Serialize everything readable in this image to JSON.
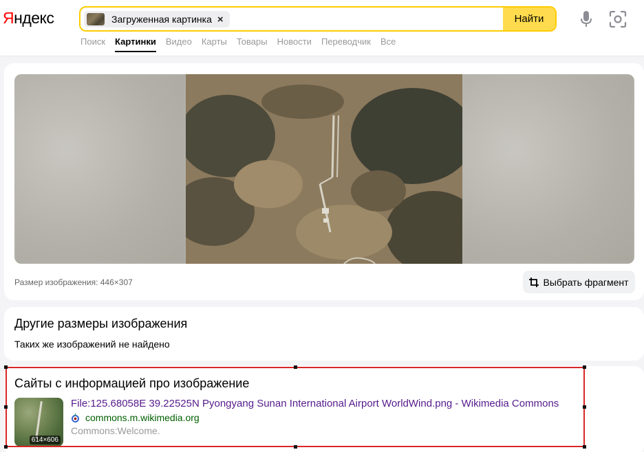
{
  "header": {
    "logo": "Яндекс",
    "chip_label": "Загруженная картинка",
    "chip_close": "×",
    "search_button": "Найти"
  },
  "nav": {
    "tabs": [
      {
        "label": "Поиск",
        "active": false
      },
      {
        "label": "Картинки",
        "active": true
      },
      {
        "label": "Видео",
        "active": false
      },
      {
        "label": "Карты",
        "active": false
      },
      {
        "label": "Товары",
        "active": false
      },
      {
        "label": "Новости",
        "active": false
      },
      {
        "label": "Переводчик",
        "active": false
      },
      {
        "label": "Все",
        "active": false
      }
    ]
  },
  "preview": {
    "size_text": "Размер изображения: 446×307",
    "fragment_button": "Выбрать фрагмент"
  },
  "sizes": {
    "title": "Другие размеры изображения",
    "subtitle": "Таких же изображений не найдено"
  },
  "sites": {
    "title": "Сайты с информацией про изображение",
    "result": {
      "title": "File:125.68058E 39.22525N Pyongyang Sunan International Airport WorldWind.png - Wikimedia Commons",
      "site": "commons.m.wikimedia.org",
      "description": "Commons:Welcome.",
      "thumb_size": "614×606"
    }
  },
  "colors": {
    "accent": "#ffdb4d",
    "selection": "#d92626",
    "link": "#551a8b",
    "site": "#006000"
  }
}
